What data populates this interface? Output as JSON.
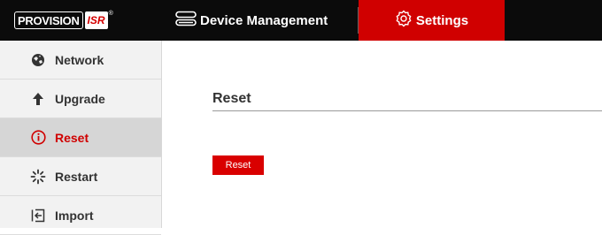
{
  "header": {
    "logo": {
      "brand": "PROVISION",
      "badge": "ISR",
      "mark": "®"
    },
    "tabs": [
      {
        "label": "Device Management",
        "icon": "device-management-icon"
      },
      {
        "label": "Settings",
        "icon": "gear-icon",
        "active": true
      }
    ]
  },
  "sidebar": {
    "items": [
      {
        "label": "Network",
        "icon": "globe-icon"
      },
      {
        "label": "Upgrade",
        "icon": "arrow-up-icon"
      },
      {
        "label": "Reset",
        "icon": "info-circle-icon",
        "active": true
      },
      {
        "label": "Restart",
        "icon": "spinner-icon"
      },
      {
        "label": "Import",
        "icon": "import-icon"
      }
    ]
  },
  "main": {
    "title": "Reset",
    "reset_button": "Reset"
  },
  "colors": {
    "accent": "#d00000",
    "topbar": "#0b0b0b",
    "sidebar_bg": "#f2f2f2",
    "sidebar_active_bg": "#d6d6d6"
  }
}
